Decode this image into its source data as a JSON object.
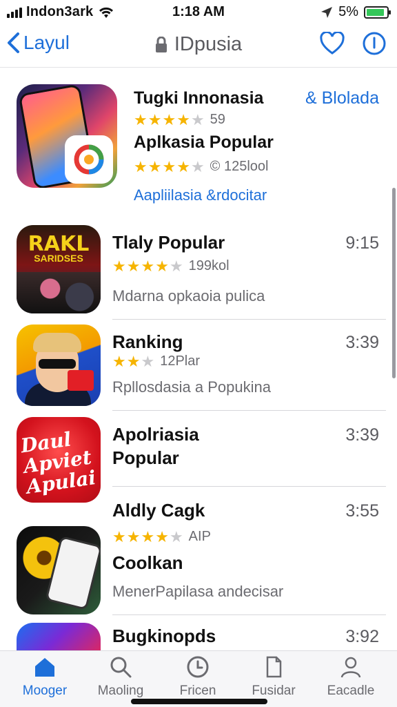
{
  "status_bar": {
    "carrier": "Indon3ark",
    "time": "1:18 AM",
    "battery_pct": "5%",
    "battery_level": 0.9,
    "icons": [
      "signal-icon",
      "wifi-icon",
      "location-icon",
      "battery-icon"
    ]
  },
  "nav": {
    "back_label": "Layul",
    "title": "IDpusia",
    "icons": [
      "chevron-left-icon",
      "lock-icon",
      "heart-icon",
      "info-icon"
    ]
  },
  "featured": {
    "title": "Tugki Innonasia",
    "action": "& Blolada",
    "rating1": 4,
    "count1": "59",
    "subtitle": "Aplkasia Popular",
    "rating2": 4,
    "count2": "© 125lool",
    "link": "Aapliilasia &rdocitar"
  },
  "items": [
    {
      "name": "Tlaly Popular",
      "time": "9:15",
      "rating": 4,
      "count": "199kol",
      "desc": "Mdarna opkaoia pulica",
      "icon_text1": "RAKL",
      "icon_text2": "SARIDSES"
    },
    {
      "name": "Ranking",
      "time": "3:39",
      "rating": 2,
      "count": "12Plar",
      "desc": "Rpllosdasia a Popukina"
    },
    {
      "name": "Apolriasia",
      "name2": "Popular",
      "time": "3:39",
      "icon_text": "Daul Apviet Apulai"
    },
    {
      "name": "Aldly Cagk",
      "time": "3:55",
      "rating": 4,
      "count": "AIP",
      "subtitle": "Coolkan",
      "desc": "MenerPapilasa andecisar"
    },
    {
      "name": "Bugkinopds",
      "time": "3:92"
    }
  ],
  "tabs": [
    {
      "label": "Mooger",
      "icon": "home-icon",
      "active": true
    },
    {
      "label": "Maoling",
      "icon": "search-icon",
      "active": false
    },
    {
      "label": "Fricen",
      "icon": "clock-icon",
      "active": false
    },
    {
      "label": "Fusidar",
      "icon": "document-icon",
      "active": false
    },
    {
      "label": "Eacadle",
      "icon": "person-icon",
      "active": false
    }
  ],
  "colors": {
    "accent": "#1e6fd9",
    "star": "#f6b400",
    "battery": "#34c759"
  }
}
